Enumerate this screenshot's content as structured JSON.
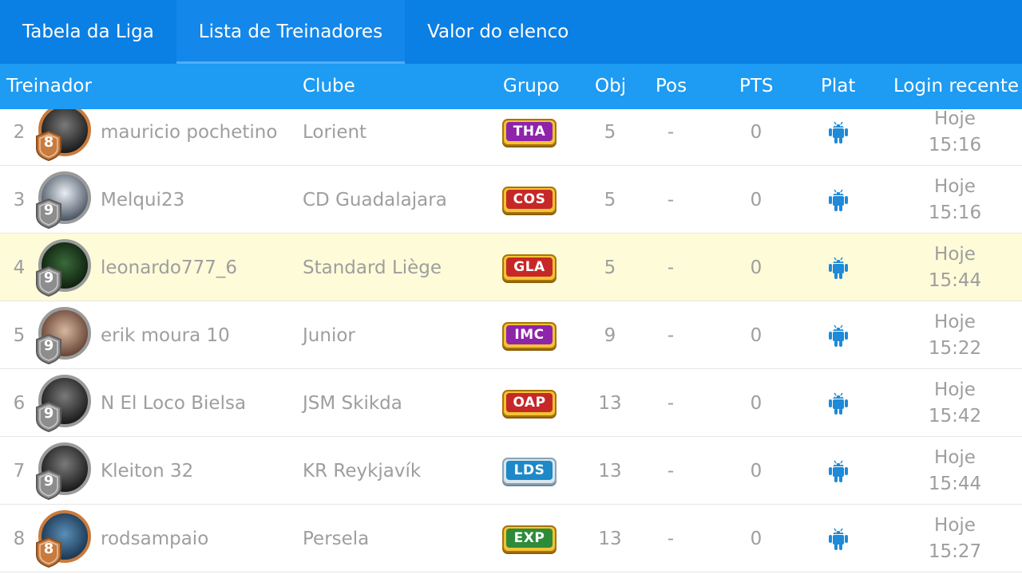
{
  "tabs": [
    {
      "label": "Tabela da Liga",
      "active": false
    },
    {
      "label": "Lista de Treinadores",
      "active": true
    },
    {
      "label": "Valor do elenco",
      "active": false
    }
  ],
  "columns": {
    "treinador": "Treinador",
    "clube": "Clube",
    "grupo": "Grupo",
    "obj": "Obj",
    "pos": "Pos",
    "pts": "PTS",
    "plat": "Plat",
    "login": "Login recente"
  },
  "rows": [
    {
      "rank": "2",
      "level": "8",
      "frame": "bronze",
      "avatar_icon": "avatar-dark-icon",
      "name": "mauricio pochetino",
      "club": "Lorient",
      "group": "THA",
      "group_color": "#8e24aa",
      "obj": "5",
      "pos": "-",
      "pts": "0",
      "platform_icon": "android-icon",
      "login_day": "Hoje",
      "login_time": "15:16",
      "highlight": false
    },
    {
      "rank": "3",
      "level": "9",
      "frame": "silver",
      "avatar_icon": "avatar-white-icon",
      "name": "Melqui23",
      "club": "CD Guadalajara",
      "group": "COS",
      "group_color": "#c62828",
      "obj": "5",
      "pos": "-",
      "pts": "0",
      "platform_icon": "android-icon",
      "login_day": "Hoje",
      "login_time": "15:16",
      "highlight": false
    },
    {
      "rank": "4",
      "level": "9",
      "frame": "silver",
      "avatar_icon": "avatar-green-icon",
      "name": "leonardo777_6",
      "club": "Standard Liège",
      "group": "GLA",
      "group_color": "#c62828",
      "obj": "5",
      "pos": "-",
      "pts": "0",
      "platform_icon": "android-icon",
      "login_day": "Hoje",
      "login_time": "15:44",
      "highlight": true
    },
    {
      "rank": "5",
      "level": "9",
      "frame": "silver",
      "avatar_icon": "avatar-face-icon",
      "name": "erik moura 10",
      "club": "Junior",
      "group": "IMC",
      "group_color": "#8e24aa",
      "obj": "9",
      "pos": "-",
      "pts": "0",
      "platform_icon": "android-icon",
      "login_day": "Hoje",
      "login_time": "15:22",
      "highlight": false
    },
    {
      "rank": "6",
      "level": "9",
      "frame": "silver",
      "avatar_icon": "avatar-dark-icon",
      "name": "N El Loco Bielsa",
      "club": "JSM Skikda",
      "group": "OAP",
      "group_color": "#c62828",
      "obj": "13",
      "pos": "-",
      "pts": "0",
      "platform_icon": "android-icon",
      "login_day": "Hoje",
      "login_time": "15:42",
      "highlight": false
    },
    {
      "rank": "7",
      "level": "9",
      "frame": "silver",
      "avatar_icon": "avatar-dark-icon",
      "name": "Kleiton 32",
      "club": "KR Reykjavík",
      "group": "LDS",
      "group_color": "#1e88c8",
      "obj": "13",
      "pos": "-",
      "pts": "0",
      "platform_icon": "android-icon",
      "login_day": "Hoje",
      "login_time": "15:44",
      "highlight": false
    },
    {
      "rank": "8",
      "level": "8",
      "frame": "bronze",
      "avatar_icon": "avatar-blue-icon",
      "name": "rodsampaio",
      "club": "Persela",
      "group": "EXP",
      "group_color": "#2e8b3a",
      "obj": "13",
      "pos": "-",
      "pts": "0",
      "platform_icon": "android-icon",
      "login_day": "Hoje",
      "login_time": "15:27",
      "highlight": false
    }
  ],
  "colors": {
    "tabbar": "#0a7fe4",
    "header": "#1e9bf2",
    "android": "#1e8ad8",
    "highlight_row": "#fefbd9",
    "bronze_frame": "#c97b3d",
    "silver_frame": "#9a9a9a"
  }
}
